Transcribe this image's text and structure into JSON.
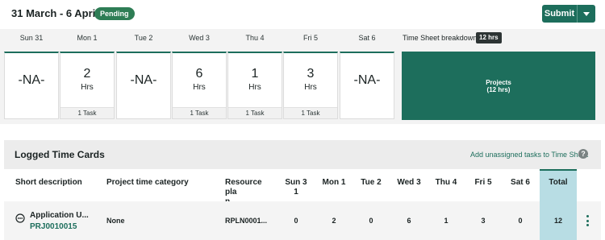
{
  "header": {
    "date_range": "31 March - 6 April 2024",
    "status_badge": "Pending",
    "submit_label": "Submit"
  },
  "days": [
    {
      "name": "Sun 31",
      "value": "-NA-",
      "unit": "",
      "footer": ""
    },
    {
      "name": "Mon 1",
      "value": "2",
      "unit": "Hrs",
      "footer": "1 Task"
    },
    {
      "name": "Tue 2",
      "value": "-NA-",
      "unit": "",
      "footer": ""
    },
    {
      "name": "Wed 3",
      "value": "6",
      "unit": "Hrs",
      "footer": "1 Task"
    },
    {
      "name": "Thu 4",
      "value": "1",
      "unit": "Hrs",
      "footer": "1 Task"
    },
    {
      "name": "Fri 5",
      "value": "3",
      "unit": "Hrs",
      "footer": "1 Task"
    },
    {
      "name": "Sat 6",
      "value": "-NA-",
      "unit": "",
      "footer": ""
    }
  ],
  "breakdown": {
    "label": "Time Sheet breakdown",
    "total_badge": "12 hrs",
    "category": "Projects",
    "category_hours": "(12 hrs)"
  },
  "logged": {
    "title": "Logged Time Cards",
    "unassigned_link": "Add unassigned tasks to Time Sheet",
    "help_icon": "?",
    "columns": {
      "short_description": "Short description",
      "project_time_category": "Project time category",
      "resource_plan_1": "Resource pla",
      "resource_plan_2": "n",
      "sun_1": "Sun 3",
      "sun_2": "1",
      "mon": "Mon 1",
      "tue": "Tue 2",
      "wed": "Wed 3",
      "thu": "Thu 4",
      "fri": "Fri 5",
      "sat": "Sat 6",
      "total": "Total"
    },
    "rows": [
      {
        "short_description": "Application U...",
        "project": "PRJ0010015",
        "time_category": "None",
        "resource_plan": "RPLN0001...",
        "sun": "0",
        "mon": "2",
        "tue": "0",
        "wed": "6",
        "thu": "1",
        "fri": "3",
        "sat": "0",
        "total": "12"
      }
    ]
  },
  "colors": {
    "accent": "#1d6e5c",
    "pending": "#2e7d55",
    "total_highlight": "#b8dde4"
  }
}
